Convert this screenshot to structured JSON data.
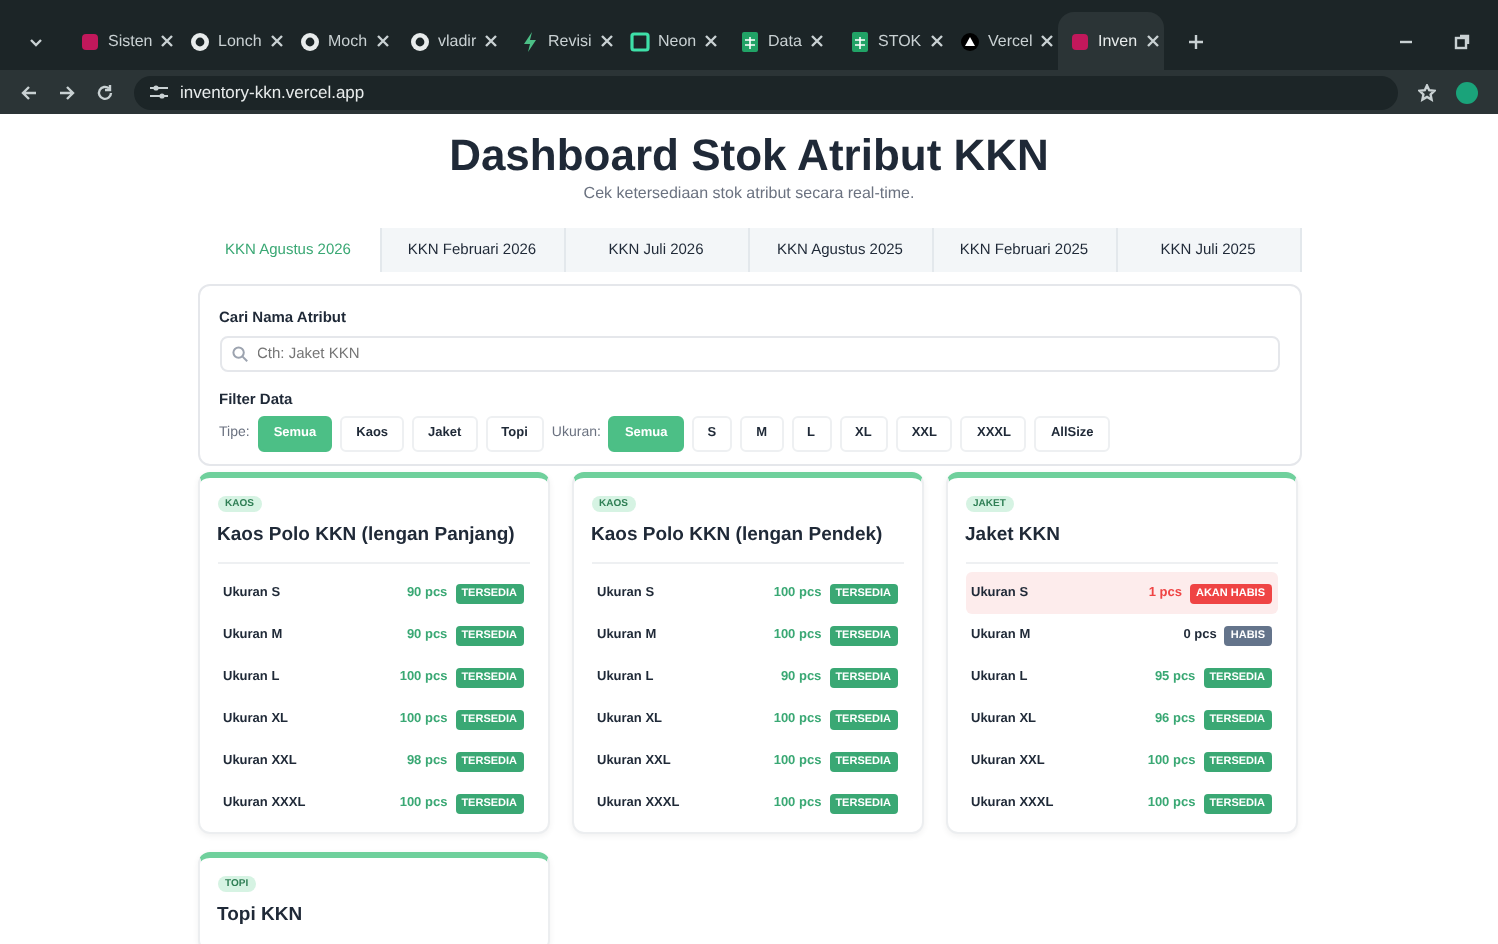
{
  "browser": {
    "tabs": [
      {
        "title": "Sisten",
        "kind": "app",
        "selected": false
      },
      {
        "title": "Lonch",
        "kind": "github",
        "selected": false
      },
      {
        "title": "Moch",
        "kind": "github",
        "selected": false
      },
      {
        "title": "vladir",
        "kind": "github",
        "selected": false
      },
      {
        "title": "Revisi",
        "kind": "bolt",
        "selected": false
      },
      {
        "title": "Neon",
        "kind": "neon",
        "selected": false
      },
      {
        "title": "Data",
        "kind": "sheet",
        "selected": false
      },
      {
        "title": "STOK",
        "kind": "sheet",
        "selected": false
      },
      {
        "title": "Vercel",
        "kind": "vercel",
        "selected": false
      },
      {
        "title": "Inven",
        "kind": "app",
        "selected": true
      }
    ],
    "url": "inventory-kkn.vercel.app"
  },
  "page": {
    "title": "Dashboard Stok Atribut KKN",
    "subtitle": "Cek ketersediaan stok atribut secara real-time.",
    "periods": [
      {
        "label": "KKN Agustus 2026",
        "selected": true
      },
      {
        "label": "KKN Februari 2026",
        "selected": false
      },
      {
        "label": "KKN Juli 2026",
        "selected": false
      },
      {
        "label": "KKN Agustus 2025",
        "selected": false
      },
      {
        "label": "KKN Februari 2025",
        "selected": false
      },
      {
        "label": "KKN Juli 2025",
        "selected": false
      }
    ],
    "search": {
      "label": "Cari Nama Atribut",
      "placeholder": "Cth: Jaket KKN"
    },
    "filter": {
      "heading": "Filter Data",
      "type_label": "Tipe:",
      "types": [
        {
          "label": "Semua",
          "selected": true
        },
        {
          "label": "Kaos",
          "selected": false
        },
        {
          "label": "Jaket",
          "selected": false
        },
        {
          "label": "Topi",
          "selected": false
        }
      ],
      "size_label": "Ukuran:",
      "sizes": [
        {
          "label": "Semua",
          "selected": true
        },
        {
          "label": "S",
          "selected": false
        },
        {
          "label": "M",
          "selected": false
        },
        {
          "label": "L",
          "selected": false
        },
        {
          "label": "XL",
          "selected": false
        },
        {
          "label": "XXL",
          "selected": false
        },
        {
          "label": "XXXL",
          "selected": false
        },
        {
          "label": "AllSize",
          "selected": false
        }
      ]
    },
    "items": [
      {
        "tag": "KAOS",
        "name": "Kaos Polo KKN (lengan Panjang)",
        "stock": [
          {
            "size": "Ukuran S",
            "qty": "90 pcs",
            "status": "TERSEDIA",
            "kind": "available"
          },
          {
            "size": "Ukuran M",
            "qty": "90 pcs",
            "status": "TERSEDIA",
            "kind": "available"
          },
          {
            "size": "Ukuran L",
            "qty": "100 pcs",
            "status": "TERSEDIA",
            "kind": "available"
          },
          {
            "size": "Ukuran XL",
            "qty": "100 pcs",
            "status": "TERSEDIA",
            "kind": "available"
          },
          {
            "size": "Ukuran XXL",
            "qty": "98 pcs",
            "status": "TERSEDIA",
            "kind": "available"
          },
          {
            "size": "Ukuran XXXL",
            "qty": "100 pcs",
            "status": "TERSEDIA",
            "kind": "available"
          }
        ]
      },
      {
        "tag": "KAOS",
        "name": "Kaos Polo KKN (lengan Pendek)",
        "stock": [
          {
            "size": "Ukuran S",
            "qty": "100 pcs",
            "status": "TERSEDIA",
            "kind": "available"
          },
          {
            "size": "Ukuran M",
            "qty": "100 pcs",
            "status": "TERSEDIA",
            "kind": "available"
          },
          {
            "size": "Ukuran L",
            "qty": "90 pcs",
            "status": "TERSEDIA",
            "kind": "available"
          },
          {
            "size": "Ukuran XL",
            "qty": "100 pcs",
            "status": "TERSEDIA",
            "kind": "available"
          },
          {
            "size": "Ukuran XXL",
            "qty": "100 pcs",
            "status": "TERSEDIA",
            "kind": "available"
          },
          {
            "size": "Ukuran XXXL",
            "qty": "100 pcs",
            "status": "TERSEDIA",
            "kind": "available"
          }
        ]
      },
      {
        "tag": "JAKET",
        "name": "Jaket KKN",
        "stock": [
          {
            "size": "Ukuran S",
            "qty": "1 pcs",
            "status": "AKAN HABIS",
            "kind": "low"
          },
          {
            "size": "Ukuran M",
            "qty": "0 pcs",
            "status": "HABIS",
            "kind": "empty"
          },
          {
            "size": "Ukuran L",
            "qty": "95 pcs",
            "status": "TERSEDIA",
            "kind": "available"
          },
          {
            "size": "Ukuran XL",
            "qty": "96 pcs",
            "status": "TERSEDIA",
            "kind": "available"
          },
          {
            "size": "Ukuran XXL",
            "qty": "100 pcs",
            "status": "TERSEDIA",
            "kind": "available"
          },
          {
            "size": "Ukuran XXXL",
            "qty": "100 pcs",
            "status": "TERSEDIA",
            "kind": "available"
          }
        ]
      },
      {
        "tag": "TOPI",
        "name": "Topi KKN"
      }
    ]
  }
}
